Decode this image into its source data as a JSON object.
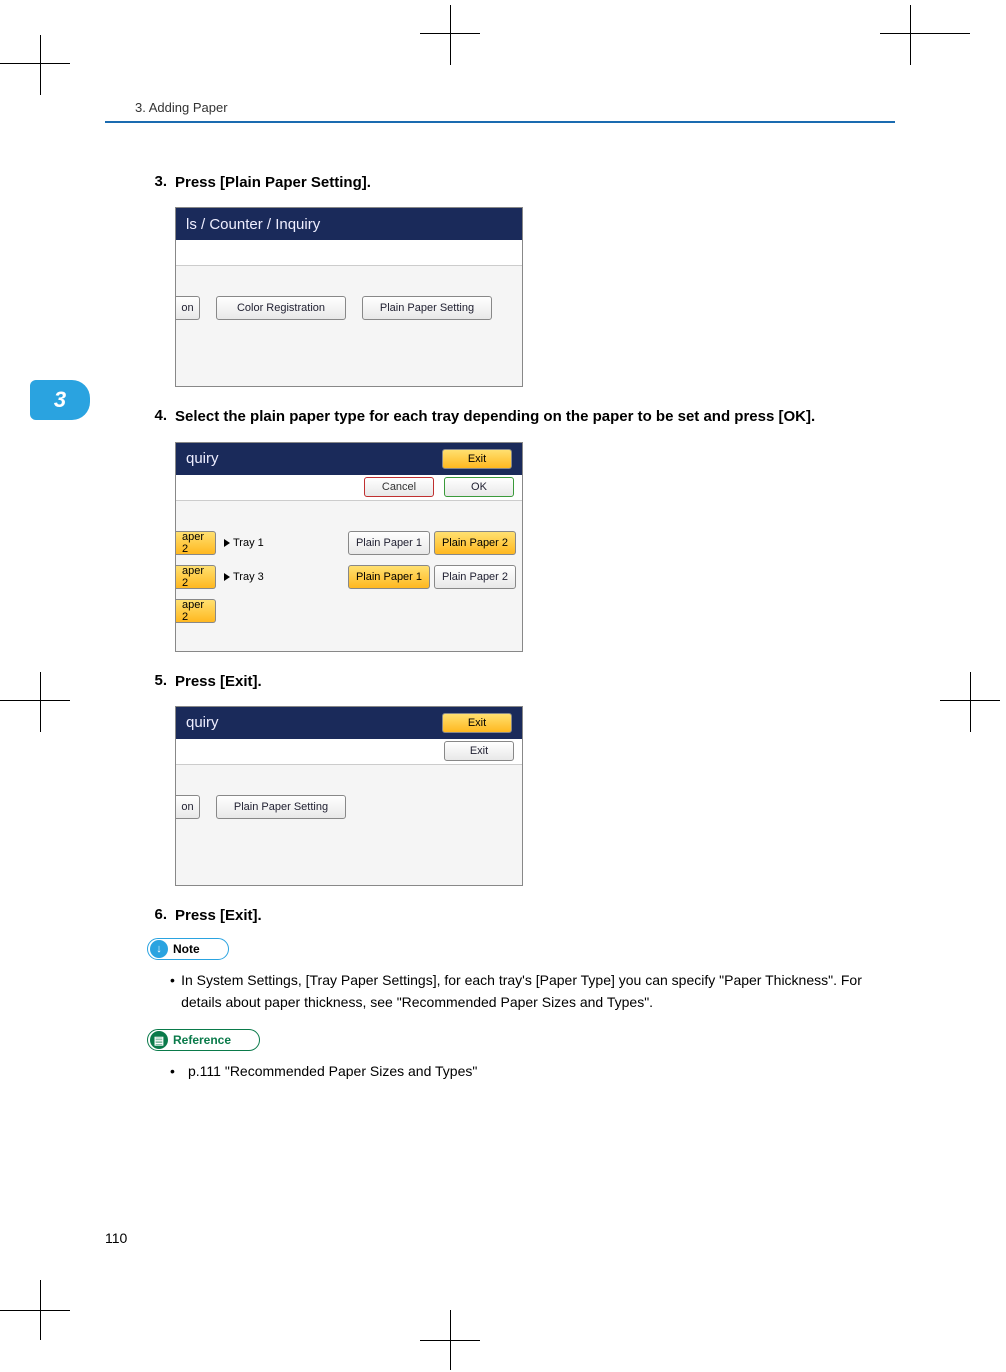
{
  "header": {
    "chapter_header": "3. Adding Paper",
    "chapter_tab": "3"
  },
  "steps": {
    "s3": {
      "num": "3.",
      "text": "Press [Plain Paper Setting]."
    },
    "s4": {
      "num": "4.",
      "text": "Select the plain paper type for each tray depending on the paper to be set and press [OK]."
    },
    "s5": {
      "num": "5.",
      "text": "Press [Exit]."
    },
    "s6": {
      "num": "6.",
      "text": "Press [Exit]."
    }
  },
  "shot1": {
    "title": "ls / Counter / Inquiry",
    "btn_cut": "on",
    "btn_color_reg": "Color Registration",
    "btn_plain_paper": "Plain Paper Setting"
  },
  "shot2": {
    "title": "quiry",
    "exit": "Exit",
    "cancel": "Cancel",
    "ok": "OK",
    "tag_a": "aper 2",
    "tag_b": "aper 2",
    "tag_c": "aper 2",
    "tray1": "Tray 1",
    "tray3": "Tray 3",
    "pp1": "Plain Paper 1",
    "pp2": "Plain Paper 2"
  },
  "shot3": {
    "title": "quiry",
    "exit": "Exit",
    "exit2": "Exit",
    "btn_cut": "on",
    "btn_plain_paper": "Plain Paper Setting"
  },
  "callouts": {
    "note_label": "Note",
    "note_bullet": "In System Settings, [Tray Paper Settings], for each tray's [Paper Type] you can specify \"Paper Thickness\". For details about paper thickness, see \"Recommended Paper Sizes and Types\".",
    "ref_label": "Reference",
    "ref_bullet": "p.111 \"Recommended Paper Sizes and Types\""
  },
  "page_number": "110"
}
